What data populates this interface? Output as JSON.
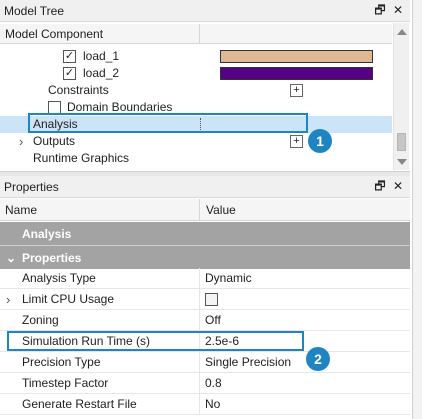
{
  "model_tree": {
    "title": "Model Tree",
    "restore_glyph": "🗗",
    "close_glyph": "✕",
    "column_header": "Model Component",
    "items": [
      {
        "label": "load_1",
        "checked": true,
        "swatch": "#deb994"
      },
      {
        "label": "load_2",
        "checked": true,
        "swatch": "#560083"
      },
      {
        "label": "Constraints"
      },
      {
        "label": "Domain Boundaries",
        "checked": false
      },
      {
        "label": "Analysis"
      },
      {
        "label": "Outputs"
      },
      {
        "label": "Runtime Graphics"
      }
    ],
    "plus_glyph": "+",
    "expand_glyph": "›",
    "check_glyph": "✓"
  },
  "properties": {
    "title": "Properties",
    "restore_glyph": "🗗",
    "close_glyph": "✕",
    "col_name": "Name",
    "col_value": "Value",
    "section_analysis": "Analysis",
    "section_properties": "Properties",
    "collapse_glyph": "⌄",
    "rows": [
      {
        "name": "Analysis Type",
        "value": "Dynamic"
      },
      {
        "name": "Limit CPU Usage",
        "value": "",
        "checkbox": true,
        "checked": false
      },
      {
        "name": "Zoning",
        "value": "Off"
      },
      {
        "name": "Simulation Run Time (s)",
        "value": "2.5e-6"
      },
      {
        "name": "Precision Type",
        "value": "Single Precision"
      },
      {
        "name": "Timestep Factor",
        "value": "0.8"
      },
      {
        "name": "Generate Restart File",
        "value": "No"
      }
    ]
  },
  "callouts": {
    "one": "1",
    "two": "2"
  },
  "colors": {
    "accent": "#1f84c2",
    "selection": "#cce4f7",
    "section": "#a3a3a3"
  }
}
